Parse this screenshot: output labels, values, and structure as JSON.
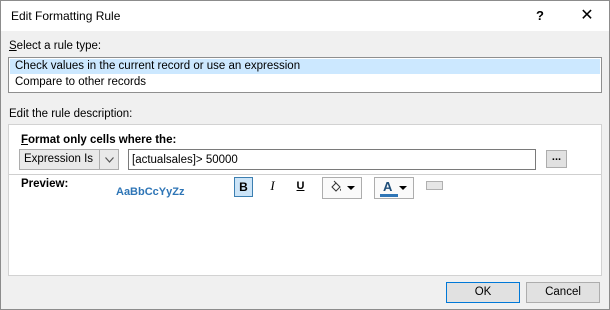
{
  "dialog": {
    "title": "Edit Formatting Rule",
    "help_label": "?",
    "close_label": "✕"
  },
  "rule_type": {
    "label_first": "S",
    "label_rest": "elect a rule type:",
    "items": [
      {
        "label": "Check values in the current record or use an expression",
        "selected": true
      },
      {
        "label": "Compare to other records",
        "selected": false
      }
    ]
  },
  "description": {
    "label": "Edit the rule description:",
    "heading_first": "F",
    "heading_rest": "ormat only cells where the:",
    "condition_value": "Expression Is",
    "expression_value": "[actualsales]> 50000",
    "ellipsis_label": "...",
    "preview_label": "Preview:",
    "preview_sample": "AaBbCcYyZz",
    "bold_label": "B",
    "italic_label": "I",
    "underline_label": "U",
    "font_color_label": "A",
    "font_color_hex": "#2e75b6",
    "bold_active": true
  },
  "buttons": {
    "ok": "OK",
    "cancel": "Cancel"
  }
}
